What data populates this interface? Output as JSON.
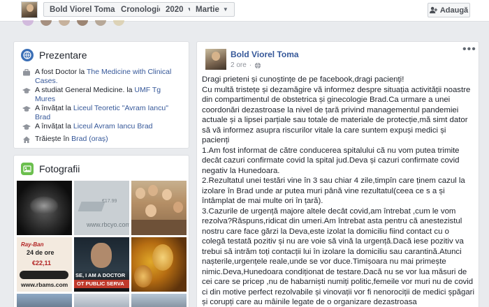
{
  "topbar": {
    "name": "Bold Viorel Toma",
    "timeline": "Cronologie",
    "year": "2020",
    "month": "Martie",
    "add_label": "Adaugă"
  },
  "intro": {
    "title": "Prezentare",
    "items": [
      {
        "prefix": "A fost Doctor la ",
        "link": "The Medicine with Clinical Cases.",
        "icon": "briefcase-icon"
      },
      {
        "prefix": "A studiat General Medicine. la ",
        "link": "UMF Tg Mures",
        "icon": "graduation-cap-icon"
      },
      {
        "prefix": "A învățat la ",
        "link": "Liceul Teoretic \"Avram Iancu\" Brad",
        "icon": "graduation-cap-icon"
      },
      {
        "prefix": "A învățat la ",
        "link": "Liceul Avram Iancu Brad",
        "icon": "graduation-cap-icon"
      },
      {
        "prefix": "Trăiește în ",
        "link": "Brad (oraș)",
        "icon": "home-icon"
      }
    ]
  },
  "photos": {
    "title": "Fotografii",
    "tiles": [
      {
        "caption": ""
      },
      {
        "caption": "www.rbcyo.com"
      },
      {
        "caption": ""
      },
      {
        "caption": "24 de ore",
        "price": "€22,11",
        "shop": "Ray-Ban",
        "site": "www.rbams.com"
      },
      {
        "caption": "SE, I AM A DOCTOR",
        "caption2": "OT PUBLIC SERVA"
      },
      {
        "caption": ""
      }
    ]
  },
  "post": {
    "author": "Bold Viorel Toma",
    "time": "2 ore",
    "paragraphs": [
      "Dragi prieteni și cunoștințe de pe facebook,dragi pacienţi!",
      "Cu multă tristețe și dezamăgire vă informez despre situația activității noastre din compartimentul de obstetrica și ginecologie Brad.Ca urmare a unei coordonări dezastroase la nivel de țară privind managementul pandemiei actuale și a lipsei parțiale sau totale de materiale de protecție,mă simt dator să vă informez asupra riscurilor vitale la care suntem expuși medici și pacienți",
      "1.Am fost informat de către conducerea spitalului că nu vom putea trimite decât cazuri confirmate covid la spital jud.Deva și cazuri confirmate covid negativ la Hunedoara.",
      "2.Rezultatul unei testări vine în 3 sau chiar 4 zile,timpîn care ținem cazul la izolare în Brad unde ar putea muri până vine rezultatul(ceea ce s a și întâmplat de mai multe ori în țară).",
      "3.Cazurile de urgență majore altele decât covid,am întrebat ,cum le vom rezolva?Răspuns,ridicat din umeri.Am întrebat asta pentru că anestezistul nostru care face gărzi la Deva,este izolat la domiciliu fiind contact cu o colegă testată pozitiv și nu are voie să vină la urgență.Dacă iese pozitiv va trebui să intrăm toți contacții lui în izolare la domiciliu sau carantină.Atunci nașterile,urgențele reale,unde se vor duce.Timișoara nu mai primește nimic.Deva,Hunedoara condiționat de testare.Dacă nu se vor lua măsuri de cei care se pricep ,nu de habarniști numiți politic,femeile vor muri nu de covid ci din motive perfect rezolvabile și vinovații vor fi nenorociții de medici șpăgari și corupți care au mâinile legate de o organizare dezastroasa"
    ]
  }
}
